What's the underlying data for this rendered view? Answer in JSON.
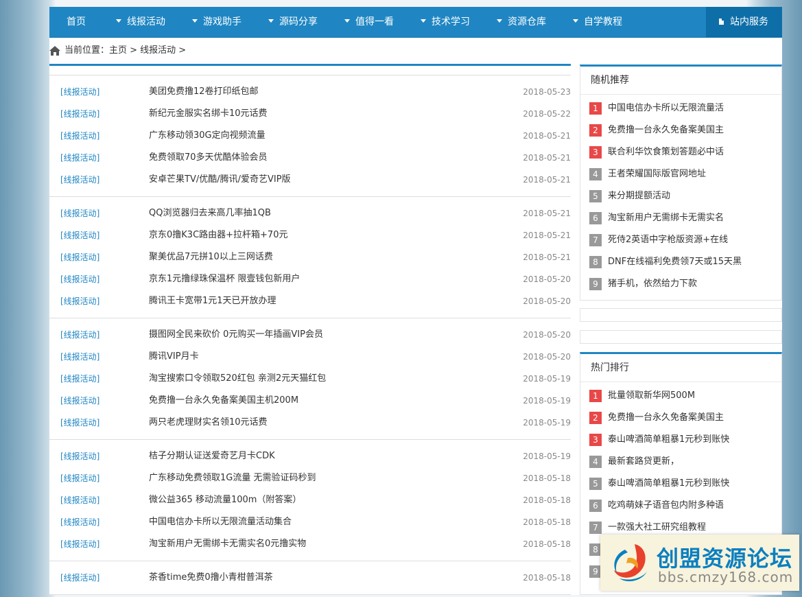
{
  "nav": {
    "items": [
      "首页",
      "线报活动",
      "游戏助手",
      "源码分享",
      "值得一看",
      "技术学习",
      "资源仓库",
      "自学教程"
    ],
    "service": "站内服务"
  },
  "breadcrumb": "当前位置：主页 > 线报活动 >",
  "article_groups": [
    [
      {
        "category": "[线报活动]",
        "title": "美团免费撸12卷打印纸包邮",
        "date": "2018-05-23"
      },
      {
        "category": "[线报活动]",
        "title": "新纪元金服实名绑卡10元话费",
        "date": "2018-05-22"
      },
      {
        "category": "[线报活动]",
        "title": "广东移动领30G定向视频流量",
        "date": "2018-05-21"
      },
      {
        "category": "[线报活动]",
        "title": "免费领取70多天优酷体验会员",
        "date": "2018-05-21"
      },
      {
        "category": "[线报活动]",
        "title": "安卓芒果TV/优酷/腾讯/爱奇艺VIP版",
        "date": "2018-05-21"
      }
    ],
    [
      {
        "category": "[线报活动]",
        "title": "QQ浏览器归去来高几率抽1QB",
        "date": "2018-05-21"
      },
      {
        "category": "[线报活动]",
        "title": "京东0撸K3C路由器+拉杆箱+70元",
        "date": "2018-05-21"
      },
      {
        "category": "[线报活动]",
        "title": "聚美优品7元拼10以上三网话费",
        "date": "2018-05-21"
      },
      {
        "category": "[线报活动]",
        "title": "京东1元撸绿珠保温杯 限壹钱包新用户",
        "date": "2018-05-20"
      },
      {
        "category": "[线报活动]",
        "title": "腾讯王卡宽带1元1天已开放办理",
        "date": "2018-05-20"
      }
    ],
    [
      {
        "category": "[线报活动]",
        "title": "摄图网全民来砍价 0元购买一年插画VIP会员",
        "date": "2018-05-20"
      },
      {
        "category": "[线报活动]",
        "title": "腾讯VIP月卡",
        "date": "2018-05-20"
      },
      {
        "category": "[线报活动]",
        "title": "淘宝搜索口令领取520红包 亲测2元天猫红包",
        "date": "2018-05-19"
      },
      {
        "category": "[线报活动]",
        "title": "免费撸一台永久免备案美国主机200M",
        "date": "2018-05-19"
      },
      {
        "category": "[线报活动]",
        "title": "两只老虎理财实名领10元话费",
        "date": "2018-05-19"
      }
    ],
    [
      {
        "category": "[线报活动]",
        "title": "桔子分期认证送爱奇艺月卡CDK",
        "date": "2018-05-19"
      },
      {
        "category": "[线报活动]",
        "title": "广东移动免费领取1G流量 无需验证码秒到",
        "date": "2018-05-18"
      },
      {
        "category": "[线报活动]",
        "title": "微公益365 移动流量100m（附答案）",
        "date": "2018-05-18"
      },
      {
        "category": "[线报活动]",
        "title": "中国电信办卡所以无限流量活动集合",
        "date": "2018-05-18"
      },
      {
        "category": "[线报活动]",
        "title": "淘宝新用户无需绑卡无需实名0元撸实物",
        "date": "2018-05-18"
      }
    ],
    [
      {
        "category": "[线报活动]",
        "title": "茶香time免费0撸小青柑普洱茶",
        "date": "2018-05-18"
      }
    ]
  ],
  "random": {
    "title": "随机推荐",
    "items": [
      {
        "rank": "1",
        "text": "中国电信办卡所以无限流量活"
      },
      {
        "rank": "2",
        "text": "免费撸一台永久免备案美国主"
      },
      {
        "rank": "3",
        "text": "联合利华饮食策划答题必中话"
      },
      {
        "rank": "4",
        "text": "王者荣耀国际版官网地址"
      },
      {
        "rank": "5",
        "text": "来分期提额活动"
      },
      {
        "rank": "6",
        "text": "淘宝新用户无需绑卡无需实名"
      },
      {
        "rank": "7",
        "text": "死侍2英语中字枪版资源+在线"
      },
      {
        "rank": "8",
        "text": "DNF在线福利免费领7天或15天黑"
      },
      {
        "rank": "9",
        "text": "猪手机，依然给力下款"
      }
    ]
  },
  "hot": {
    "title": "热门排行",
    "items": [
      {
        "rank": "1",
        "text": "批量领取新华网500M"
      },
      {
        "rank": "2",
        "text": "免费撸一台永久免备案美国主"
      },
      {
        "rank": "3",
        "text": "泰山啤酒简单粗暴1元秒到账快"
      },
      {
        "rank": "4",
        "text": "最新套路贷更新，"
      },
      {
        "rank": "5",
        "text": "泰山啤酒简单粗暴1元秒到账快"
      },
      {
        "rank": "6",
        "text": "吃鸡萌妹子语音包内附多种语"
      },
      {
        "rank": "7",
        "text": "一款强大社工研究组教程"
      },
      {
        "rank": "8",
        "text": ""
      },
      {
        "rank": "9",
        "text": ""
      }
    ]
  },
  "watermark": {
    "name": "创盟资源论坛",
    "url": "bbs.cmzy168.com"
  },
  "colors": {
    "primary": "#1f86c3",
    "hot_rank": "#e84848",
    "rank": "#999999"
  }
}
